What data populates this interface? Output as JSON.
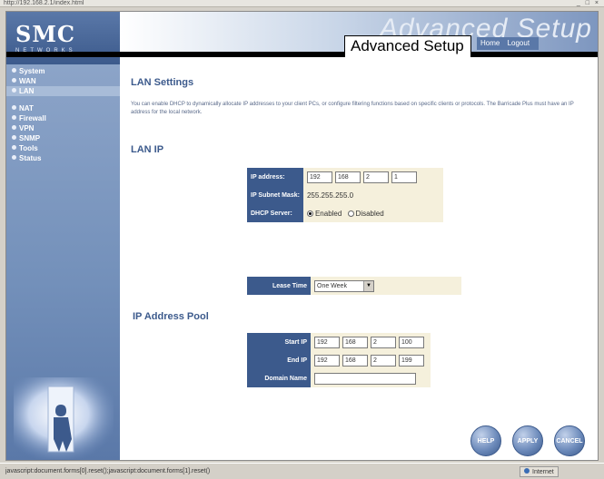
{
  "browser": {
    "address": "http://192.168.2.1/index.html",
    "win_controls": "_ □ ×",
    "status_url": "javascript:document.forms[0].reset();javascript:document.forms[1].reset()",
    "zone_label": "Internet"
  },
  "header": {
    "logo": "SMC",
    "logo_sub": "NETWORKS",
    "ghost_title": "Advanced Setup",
    "setup_title": "Advanced Setup",
    "links": [
      "Home",
      "Logout"
    ]
  },
  "sidebar": {
    "items": [
      {
        "label": "System",
        "active": false
      },
      {
        "label": "WAN",
        "active": false
      },
      {
        "label": "LAN",
        "active": true
      },
      {
        "label": "NAT",
        "active": false
      },
      {
        "label": "Firewall",
        "active": false
      },
      {
        "label": "VPN",
        "active": false
      },
      {
        "label": "SNMP",
        "active": false
      },
      {
        "label": "Tools",
        "active": false
      },
      {
        "label": "Status",
        "active": false
      }
    ]
  },
  "content": {
    "title": "LAN Settings",
    "description": "You can enable DHCP to dynamically allocate IP addresses to your client PCs, or configure filtering functions based on specific clients or protocols. The Barricade Plus must have an IP address for the local network.",
    "lan_ip_title": "LAN IP",
    "ip_label": "IP address:",
    "ip_octets": [
      "192",
      "168",
      "2",
      "1"
    ],
    "mask_label": "IP Subnet Mask:",
    "mask_value": "255.255.255.0",
    "dhcp_label": "DHCP Server:",
    "dhcp_enabled": "Enabled",
    "dhcp_disabled": "Disabled",
    "lease_label": "Lease Time",
    "lease_value": "One Week",
    "pool_title": "IP Address Pool",
    "start_label": "Start IP",
    "start_octets": [
      "192",
      "168",
      "2",
      "100"
    ],
    "end_label": "End IP",
    "end_octets": [
      "192",
      "168",
      "2",
      "199"
    ],
    "domain_label": "Domain Name",
    "domain_value": ""
  },
  "buttons": {
    "help": "HELP",
    "apply": "APPLY",
    "cancel": "CANCEL"
  },
  "colors": {
    "brand_blue": "#3c5a8c",
    "sidebar_blue": "#7390ba",
    "field_bg": "#f5f0dc"
  }
}
